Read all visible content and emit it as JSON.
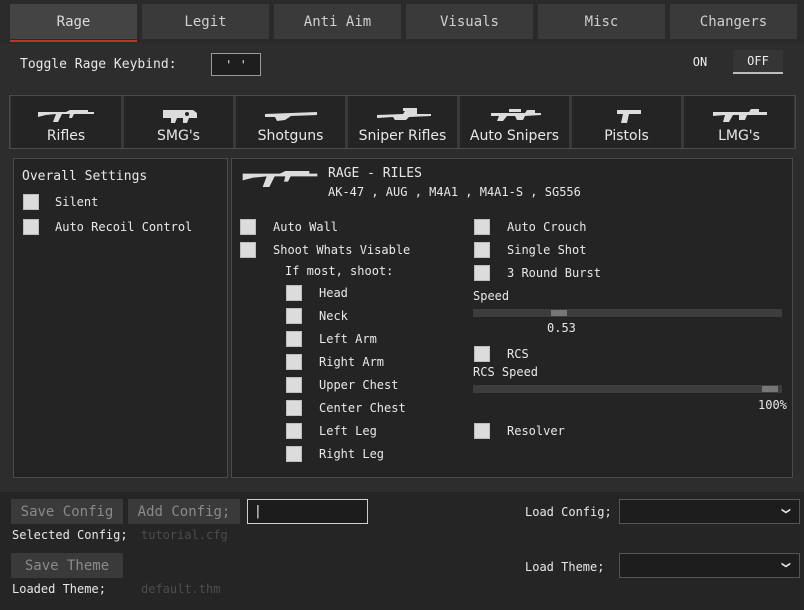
{
  "tabs": [
    {
      "label": "Rage",
      "active": true
    },
    {
      "label": "Legit",
      "active": false
    },
    {
      "label": "Anti Aim",
      "active": false
    },
    {
      "label": "Visuals",
      "active": false
    },
    {
      "label": "Misc",
      "active": false
    },
    {
      "label": "Changers",
      "active": false
    }
  ],
  "keybind": {
    "label": "Toggle Rage Keybind:",
    "value": "' '"
  },
  "toggle": {
    "on_label": "ON",
    "off_label": "OFF",
    "selected": "OFF"
  },
  "weapon_categories": [
    {
      "label": "Rifles",
      "icon": "rifle-icon"
    },
    {
      "label": "SMG's",
      "icon": "smg-icon"
    },
    {
      "label": "Shotguns",
      "icon": "shotgun-icon"
    },
    {
      "label": "Sniper Rifles",
      "icon": "sniper-rifle-icon"
    },
    {
      "label": "Auto Snipers",
      "icon": "auto-sniper-icon"
    },
    {
      "label": "Pistols",
      "icon": "pistol-icon"
    },
    {
      "label": "LMG's",
      "icon": "lmg-icon"
    }
  ],
  "overall": {
    "title": "Overall Settings",
    "items": [
      {
        "label": "Silent",
        "checked": false
      },
      {
        "label": "Auto Recoil Control",
        "checked": false
      }
    ]
  },
  "rage": {
    "title": "RAGE - RILES",
    "weapons": "AK-47 , AUG , M4A1 , M4A1-S , SG556",
    "auto_wall": "Auto Wall",
    "shoot_visible": "Shoot Whats Visable",
    "if_most": "If most, shoot:",
    "hitboxes": [
      "Head",
      "Neck",
      "Left Arm",
      "Right Arm",
      "Upper Chest",
      "Center Chest",
      "Left Leg",
      "Right Leg"
    ],
    "auto_crouch": "Auto Crouch",
    "single_shot": "Single Shot",
    "round_burst": "3 Round Burst",
    "speed_label": "Speed",
    "speed_value": "0.53",
    "speed_fraction": 0.53,
    "rcs_label": "RCS",
    "rcs_speed_label": "RCS Speed",
    "rcs_speed_value": "100%",
    "rcs_speed_fraction": 1.0,
    "resolver": "Resolver"
  },
  "config": {
    "save_label": "Save Config",
    "add_label": "Add Config;",
    "input_value": "|",
    "selected_label": "Selected Config;",
    "selected_value": "tutorial.cfg",
    "load_label": "Load Config;",
    "load_value": ""
  },
  "theme": {
    "save_label": "Save Theme",
    "loaded_label": "Loaded Theme;",
    "loaded_value": "default.thm",
    "load_label": "Load Theme;",
    "load_value": ""
  },
  "colors": {
    "accent": "#c0312b",
    "background": "#2d2d2d",
    "panel": "#242424"
  }
}
